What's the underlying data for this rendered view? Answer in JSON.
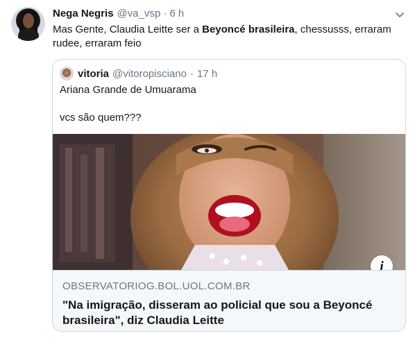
{
  "tweet": {
    "author_name": "Nega Negris",
    "author_handle": "@va_vsp",
    "separator": "·",
    "time": "6 h",
    "text_before": "Mas Gente, Claudia Leitte ser a ",
    "text_bold": "Beyoncé brasileira",
    "text_after": ", chessusss, erraram rudee, erraram feio"
  },
  "quoted": {
    "author_name": "vitoria",
    "author_handle": "@vitoropisciano",
    "separator": "·",
    "time": "17 h",
    "line1": "Ariana Grande de Umuarama",
    "line2": "vcs são quem???"
  },
  "link_card": {
    "domain": "OBSERVATORIOG.BOL.UOL.COM.BR",
    "title": "\"Na imigração, disseram ao policial que sou a Beyoncé brasileira\", diz Claudia Leitte",
    "info_glyph": "i"
  },
  "icons": {
    "menu": "chevron-down-icon",
    "info": "info-icon"
  },
  "colors": {
    "text_primary": "#14171a",
    "text_secondary": "#657786",
    "border": "#ccd6dd",
    "card_bg": "#f5f8fa"
  }
}
